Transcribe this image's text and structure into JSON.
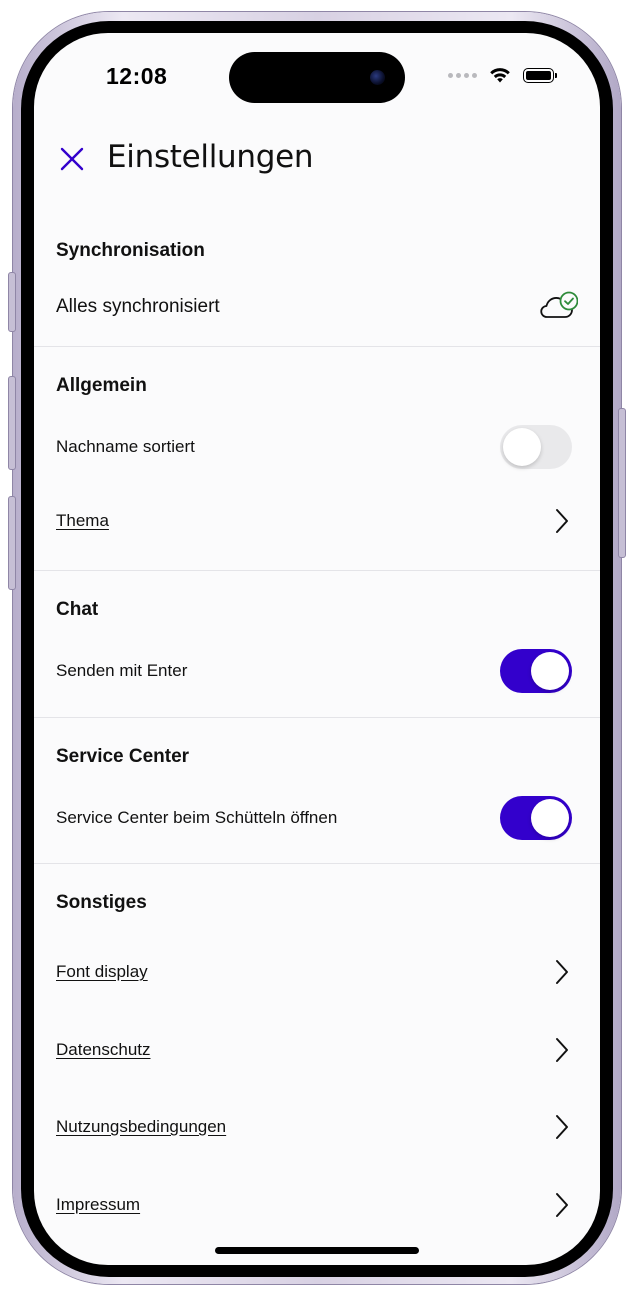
{
  "status_bar": {
    "time": "12:08"
  },
  "header": {
    "title": "Einstellungen",
    "close_icon": "close-icon"
  },
  "sections": {
    "sync": {
      "title": "Synchronisation",
      "status_label": "Alles synchronisiert",
      "status_icon": "cloud-check-icon"
    },
    "general": {
      "title": "Allgemein",
      "sort_lastname_label": "Nachname sortiert",
      "sort_lastname_enabled": false,
      "theme_label": "Thema"
    },
    "chat": {
      "title": "Chat",
      "send_enter_label": "Senden mit Enter",
      "send_enter_enabled": true
    },
    "service_center": {
      "title": "Service Center",
      "shake_label": "Service Center beim Schütteln öffnen",
      "shake_enabled": true
    },
    "other": {
      "title": "Sonstiges",
      "items": [
        "Font display",
        "Datenschutz",
        "Nutzungsbedingungen",
        "Impressum"
      ]
    }
  },
  "colors": {
    "accent": "#3300CC",
    "toggle_off": "#E9E9EB",
    "sync_ok": "#2E8B3A"
  }
}
